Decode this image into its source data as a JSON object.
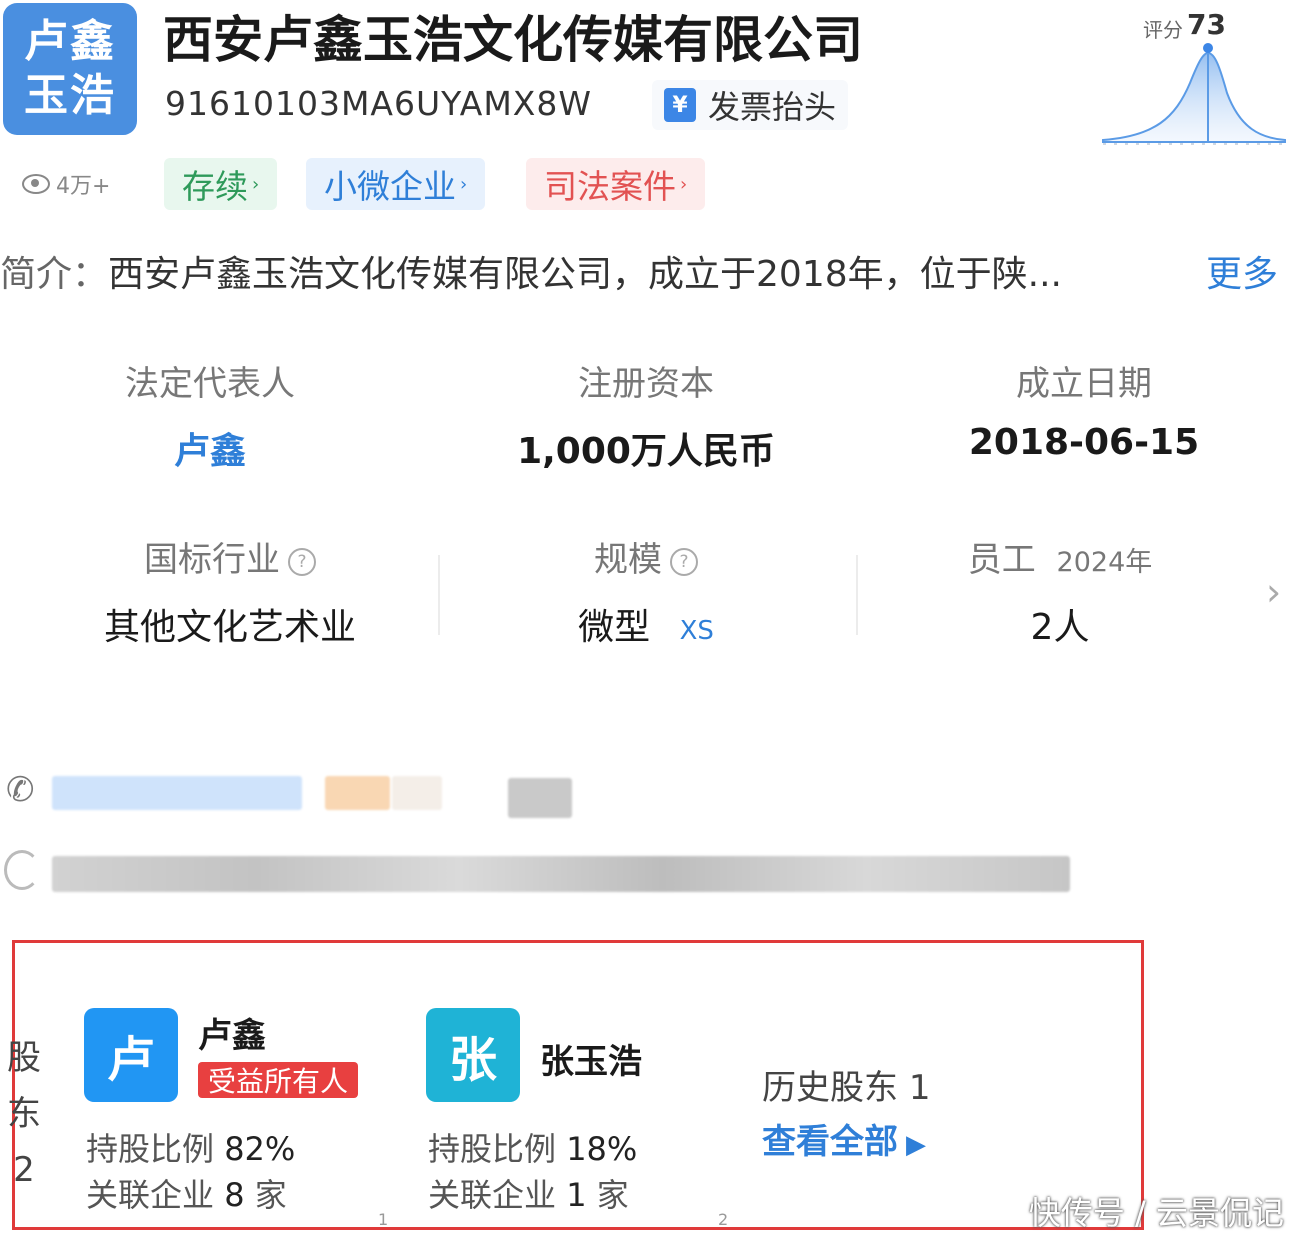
{
  "header": {
    "logo_line1": "卢鑫",
    "logo_line2": "玉浩",
    "company_name": "西安卢鑫玉浩文化传媒有限公司",
    "credit_code": "91610103MA6UYAMX8W",
    "invoice_icon": "¥",
    "invoice_label": "发票抬头",
    "score_label": "评分",
    "score_value": "73"
  },
  "meta": {
    "views": "4万+",
    "tags": [
      {
        "label": "存续",
        "color": "#2e9a5a"
      },
      {
        "label": "小微企业",
        "color": "#2f7fd8"
      },
      {
        "label": "司法案件",
        "color": "#e25252"
      }
    ]
  },
  "intro": {
    "label": "简介：",
    "text": "西安卢鑫玉浩文化传媒有限公司，成立于2018年，位于陕...",
    "more": "更多"
  },
  "info": {
    "legal_rep_label": "法定代表人",
    "legal_rep_value": "卢鑫",
    "capital_label": "注册资本",
    "capital_value": "1,000万人民币",
    "founded_label": "成立日期",
    "founded_value": "2018-06-15",
    "industry_label": "国标行业",
    "industry_value": "其他文化艺术业",
    "scale_label": "规模",
    "scale_value": "微型",
    "scale_tag": "XS",
    "staff_label": "员工",
    "staff_year": "2024年",
    "staff_value": "2人",
    "help_glyph": "?"
  },
  "shareholders": {
    "side_label": [
      "股",
      "东",
      "2"
    ],
    "items": [
      {
        "avatar": "卢",
        "name": "卢鑫",
        "badge": "受益所有人",
        "share_label": "持股比例",
        "share_value": "82%",
        "related_label": "关联企业",
        "related_count": "8",
        "related_unit": "家",
        "page": "1"
      },
      {
        "avatar": "张",
        "name": "张玉浩",
        "share_label": "持股比例",
        "share_value": "18%",
        "related_label": "关联企业",
        "related_count": "1",
        "related_unit": "家",
        "page": "2"
      }
    ],
    "history_label": "历史股东",
    "history_count": "1",
    "view_all": "查看全部"
  },
  "watermark": "快传号 / 云景侃记",
  "colors": {
    "accent": "#2f7fd8",
    "highlight_border": "#e03a3a"
  }
}
